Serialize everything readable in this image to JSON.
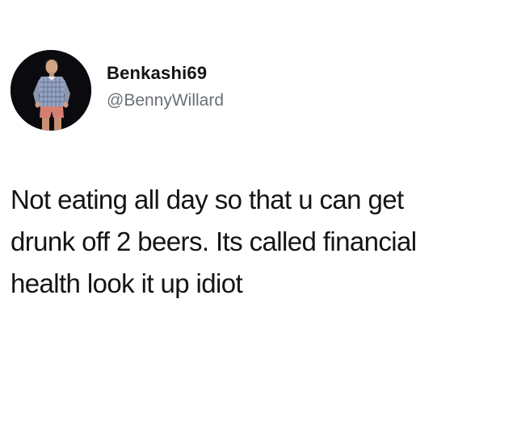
{
  "tweet": {
    "author": {
      "display_name": "Benkashi69",
      "handle": "@BennyWillard",
      "avatar_icon": "profile-photo-man-in-plaid-shirt"
    },
    "text": "Not eating all day so that u can get\ndrunk off 2 beers. Its called financial\nhealth look it up idiot"
  },
  "colors": {
    "background": "#ffffff",
    "text": "#141414",
    "handle": "#6b7075",
    "avatar_background": "#0b0b0f"
  }
}
